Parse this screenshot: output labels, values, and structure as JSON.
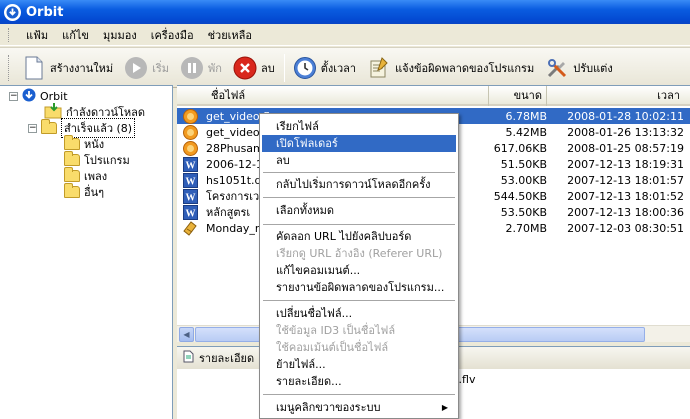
{
  "window": {
    "title": "Orbit"
  },
  "menu": [
    "แฟ้ม",
    "แก้ไข",
    "มุมมอง",
    "เครื่องมือ",
    "ช่วยเหลือ"
  ],
  "toolbar": {
    "new_task": "สร้างงานใหม่",
    "start": "เริ่ม",
    "pause": "พัก",
    "delete": "ลบ",
    "schedule": "ตั้งเวลา",
    "report_bug": "แจ้งข้อผิดพลาดของโปรแกรม",
    "settings": "ปรับแต่ง"
  },
  "tree": {
    "root": "Orbit",
    "downloading": "กำลังดาวน์โหลด",
    "completed": "สำเร็จแล้ว",
    "completed_count": "(8)",
    "categories": [
      "หนัง",
      "โปรแกรม",
      "เพลง",
      "อื่นๆ"
    ]
  },
  "list": {
    "columns": {
      "name": "ชื่อไฟล์",
      "size": "ขนาด",
      "time": "เวลา"
    },
    "rows": [
      {
        "name": "get_video.flv",
        "size": "6.78MB",
        "time": "2008-01-28 10:02:11",
        "icon": "video-file-icon"
      },
      {
        "name": "get_video",
        "size": "5.42MB",
        "time": "2008-01-26 13:13:32",
        "icon": "video-file-icon"
      },
      {
        "name": "28Phusam",
        "size": "617.06KB",
        "time": "2008-01-25 08:57:19",
        "icon": "video-file-icon"
      },
      {
        "name": "2006-12-1",
        "size": "51.50KB",
        "time": "2007-12-13 18:19:31",
        "icon": "word-document-icon"
      },
      {
        "name": "hs1051t.d",
        "size": "53.00KB",
        "time": "2007-12-13 18:01:57",
        "icon": "word-document-icon"
      },
      {
        "name": "โครงการเว",
        "size": "544.50KB",
        "time": "2007-12-13 18:01:52",
        "icon": "word-document-icon"
      },
      {
        "name": "หลักสูตรเ",
        "size": "53.50KB",
        "time": "2007-12-13 18:00:36",
        "icon": "word-document-icon"
      },
      {
        "name": "Monday_m",
        "size": "2.70MB",
        "time": "2007-12-03 08:30:51",
        "icon": "archive-file-icon"
      }
    ]
  },
  "details": {
    "tab_label": "รายละเอียด",
    "file_suffix": "o.flv"
  },
  "context_menu": {
    "items": [
      {
        "label": "เรียกไฟล์",
        "state": "normal"
      },
      {
        "label": "เปิดโฟลเดอร์",
        "state": "highlight"
      },
      {
        "label": "ลบ",
        "state": "normal"
      },
      {
        "label": "กลับไปเริ่มการดาวน์โหลดอีกครั้ง",
        "state": "normal"
      },
      {
        "label": "เลือกทั้งหมด",
        "state": "normal"
      },
      {
        "label": "คัดลอก URL ไปยังคลิปบอร์ด",
        "state": "normal"
      },
      {
        "label": "เรียกดู URL อ้างอิง (Referer URL)",
        "state": "disabled"
      },
      {
        "label": "แก้ไขคอมเมนต์...",
        "state": "normal"
      },
      {
        "label": "รายงานข้อผิดพลาดของโปรแกรม...",
        "state": "normal"
      },
      {
        "label": "เปลี่ยนชื่อไฟล์...",
        "state": "normal"
      },
      {
        "label": "ใช้ข้อมูล ID3 เป็นชื่อไฟล์",
        "state": "disabled"
      },
      {
        "label": "ใช้คอมเม้นต์เป็นชื่อไฟล์",
        "state": "disabled"
      },
      {
        "label": "ย้ายไฟล์...",
        "state": "normal"
      },
      {
        "label": "รายละเอียด...",
        "state": "normal"
      },
      {
        "label": "เมนูคลิกขวาของระบบ",
        "state": "normal"
      }
    ]
  },
  "colors": {
    "selection": "#316ac5",
    "titlebar": "#0a5ce0",
    "window_bg": "#ece9d8"
  }
}
